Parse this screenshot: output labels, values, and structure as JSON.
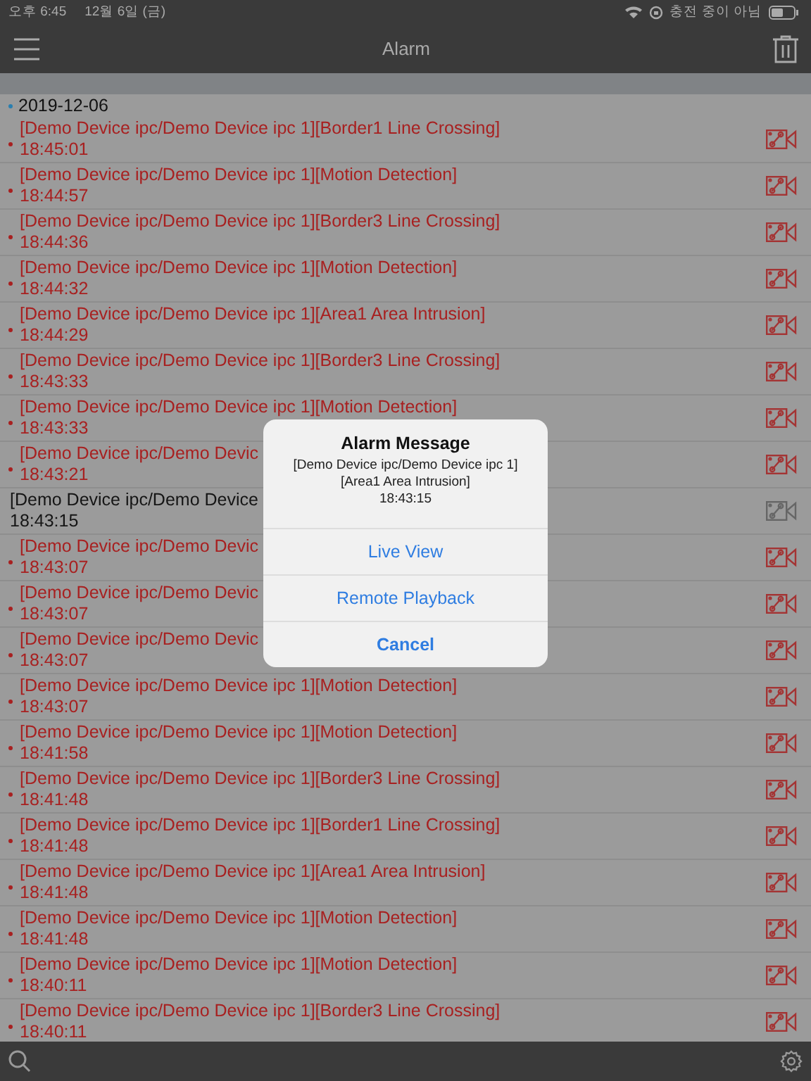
{
  "status_bar": {
    "time": "오후 6:45",
    "date": "12월 6일 (금)",
    "charging": "충전 중이 아님"
  },
  "nav": {
    "title": "Alarm"
  },
  "date_header": "2019-12-06",
  "alarms": [
    {
      "text": "[Demo Device ipc/Demo Device ipc 1][Border1 Line Crossing]",
      "time": "18:45:01",
      "read": false
    },
    {
      "text": "[Demo Device ipc/Demo Device ipc 1][Motion Detection]",
      "time": "18:44:57",
      "read": false
    },
    {
      "text": "[Demo Device ipc/Demo Device ipc 1][Border3 Line Crossing]",
      "time": "18:44:36",
      "read": false
    },
    {
      "text": "[Demo Device ipc/Demo Device ipc 1][Motion Detection]",
      "time": "18:44:32",
      "read": false
    },
    {
      "text": "[Demo Device ipc/Demo Device ipc 1][Area1 Area Intrusion]",
      "time": "18:44:29",
      "read": false
    },
    {
      "text": "[Demo Device ipc/Demo Device ipc 1][Border3 Line Crossing]",
      "time": "18:43:33",
      "read": false
    },
    {
      "text": "[Demo Device ipc/Demo Device ipc 1][Motion Detection]",
      "time": "18:43:33",
      "read": false
    },
    {
      "text": "[Demo Device ipc/Demo Devic",
      "time": "18:43:21",
      "read": false
    },
    {
      "text": "[Demo Device ipc/Demo Device",
      "time": "18:43:15",
      "read": true
    },
    {
      "text": "[Demo Device ipc/Demo Devic",
      "time": "18:43:07",
      "read": false
    },
    {
      "text": "[Demo Device ipc/Demo Devic",
      "time": "18:43:07",
      "read": false
    },
    {
      "text": "[Demo Device ipc/Demo Devic",
      "time": "18:43:07",
      "read": false
    },
    {
      "text": "[Demo Device ipc/Demo Device ipc 1][Motion Detection]",
      "time": "18:43:07",
      "read": false
    },
    {
      "text": "[Demo Device ipc/Demo Device ipc 1][Motion Detection]",
      "time": "18:41:58",
      "read": false
    },
    {
      "text": "[Demo Device ipc/Demo Device ipc 1][Border3 Line Crossing]",
      "time": "18:41:48",
      "read": false
    },
    {
      "text": "[Demo Device ipc/Demo Device ipc 1][Border1 Line Crossing]",
      "time": "18:41:48",
      "read": false
    },
    {
      "text": "[Demo Device ipc/Demo Device ipc 1][Area1 Area Intrusion]",
      "time": "18:41:48",
      "read": false
    },
    {
      "text": "[Demo Device ipc/Demo Device ipc 1][Motion Detection]",
      "time": "18:41:48",
      "read": false
    },
    {
      "text": "[Demo Device ipc/Demo Device ipc 1][Motion Detection]",
      "time": "18:40:11",
      "read": false
    },
    {
      "text": "[Demo Device ipc/Demo Device ipc 1][Border3 Line Crossing]",
      "time": "18:40:11",
      "read": false
    }
  ],
  "dialog": {
    "title": "Alarm Message",
    "message_lines": [
      "[Demo Device ipc/Demo Device ipc 1]",
      "[Area1 Area Intrusion]",
      "18:43:15"
    ],
    "buttons": [
      {
        "label": "Live View",
        "kind": "action"
      },
      {
        "label": "Remote Playback",
        "kind": "action"
      },
      {
        "label": "Cancel",
        "kind": "cancel"
      }
    ]
  }
}
